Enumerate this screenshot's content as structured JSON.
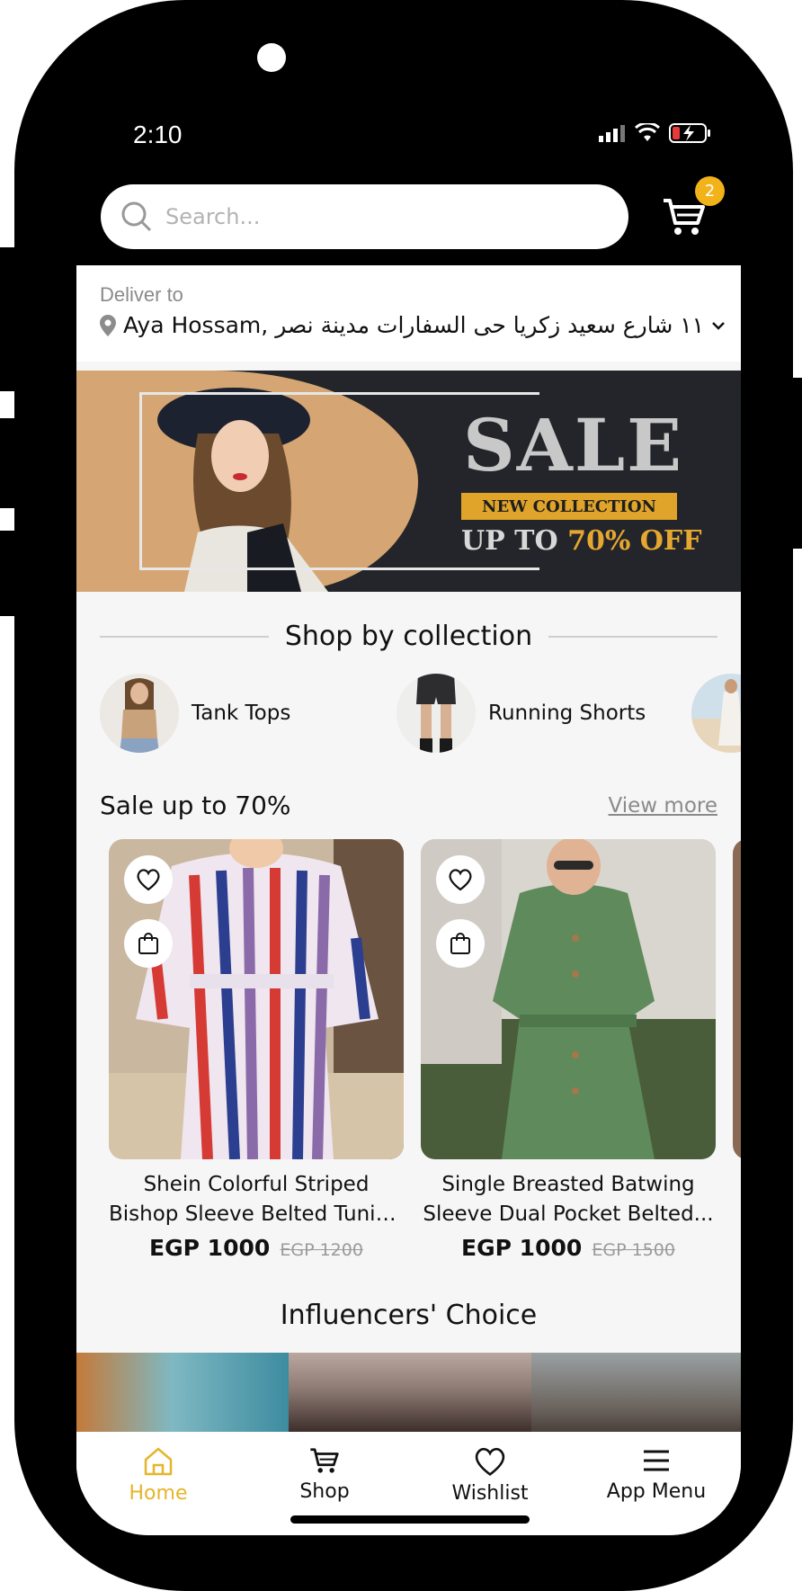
{
  "status": {
    "time": "2:10"
  },
  "search": {
    "placeholder": "Search..."
  },
  "cart": {
    "badge": "2"
  },
  "deliver": {
    "label": "Deliver to",
    "address": "Aya Hossam, ١١ شارع سعيد زكريا حى السفارات مدينة نصر"
  },
  "banner": {
    "sale": "SALE",
    "new_collection": "NEW COLLECTION",
    "up_to": "UP TO",
    "percent": "70% OFF"
  },
  "collections": {
    "title": "Shop by collection",
    "items": [
      {
        "label": "Tank Tops"
      },
      {
        "label": "Running Shorts"
      }
    ]
  },
  "sale_section": {
    "title": "Sale up to 70%",
    "view_more": "View more",
    "products": [
      {
        "name_line1": "Shein Colorful Striped",
        "name_line2": "Bishop Sleeve Belted Tunic...",
        "price": "EGP 1000",
        "old_price": "EGP 1200"
      },
      {
        "name_line1": "Single Breasted Batwing",
        "name_line2": "Sleeve Dual Pocket Belted...",
        "price": "EGP 1000",
        "old_price": "EGP 1500"
      }
    ]
  },
  "influencers": {
    "title": "Influencers' Choice"
  },
  "nav": {
    "items": [
      {
        "label": "Home",
        "icon": "home-icon",
        "active": true
      },
      {
        "label": "Shop",
        "icon": "cart-icon"
      },
      {
        "label": "Wishlist",
        "icon": "heart-icon"
      },
      {
        "label": "App Menu",
        "icon": "menu-icon"
      }
    ]
  },
  "colors": {
    "accent": "#f2b21a",
    "active_nav": "#e5b52a",
    "banner_bg": "#23252a"
  }
}
